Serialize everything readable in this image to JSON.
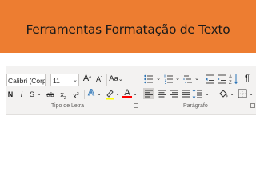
{
  "slide": {
    "title": "Ferramentas Formatação de Texto"
  },
  "ribbon": {
    "font": {
      "font_name": "Calibri (Corpo",
      "font_size": "11",
      "grow_label": "A",
      "shrink_label": "A",
      "case_label": "Aa",
      "bold_label": "N",
      "italic_label": "I",
      "underline_label": "S",
      "strike_label": "ab",
      "subscript_label": "x",
      "subscript_sub": "2",
      "superscript_label": "x",
      "superscript_sup": "2",
      "effects_label": "A",
      "color_label": "A",
      "group_label": "Tipo de Letra"
    },
    "paragraph": {
      "group_label": "Parágrafo"
    },
    "colors": {
      "highlight": "#ffff00",
      "font_color": "#ff0000",
      "effects": "#2e75b6"
    }
  }
}
